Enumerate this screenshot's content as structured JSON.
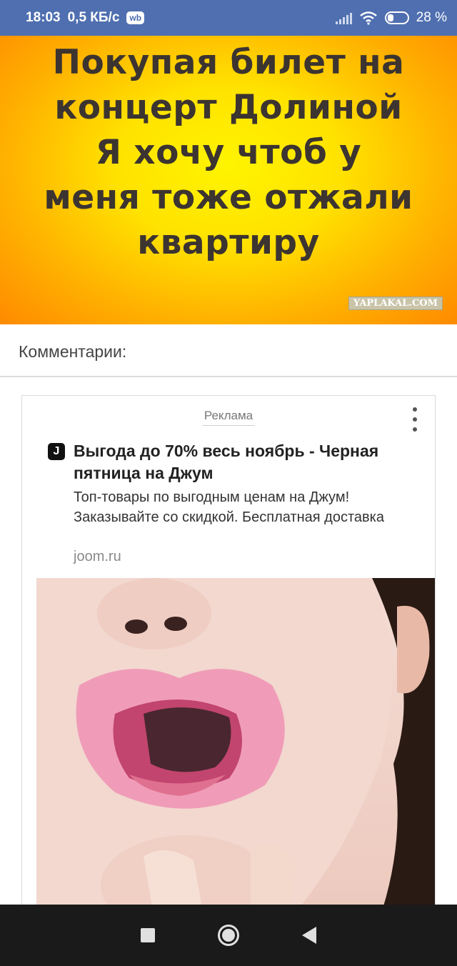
{
  "status_bar": {
    "time": "18:03",
    "speed": "0,5 КБ/с",
    "wb_badge": "wb",
    "battery": "28 %"
  },
  "meme": {
    "lines": [
      "Покупая билет на",
      "концерт Долиной",
      "Я хочу чтоб у",
      "меня тоже отжали",
      "квартиру"
    ],
    "watermark": "YAPLAKAL.COM"
  },
  "comments": {
    "title": "Комментарии:"
  },
  "ad": {
    "label": "Реклама",
    "icon_letter": "J",
    "title": "Выгода до 70% весь ноябрь - Черная пятница на Джум",
    "description": "Топ-товары по выгодным ценам на Джум! Заказывайте со скидкой. Бесплатная доставка",
    "domain": "joom.ru"
  },
  "colors": {
    "status_bar": "#4f6fb0",
    "meme_yellow": "#fff400",
    "meme_orange": "#ff8a00",
    "nav_bar": "#1a1a1a"
  },
  "icons": {
    "kebab": "more-vert-icon",
    "back": "back-triangle-icon",
    "home": "home-circle-icon",
    "recents": "recents-square-icon"
  }
}
